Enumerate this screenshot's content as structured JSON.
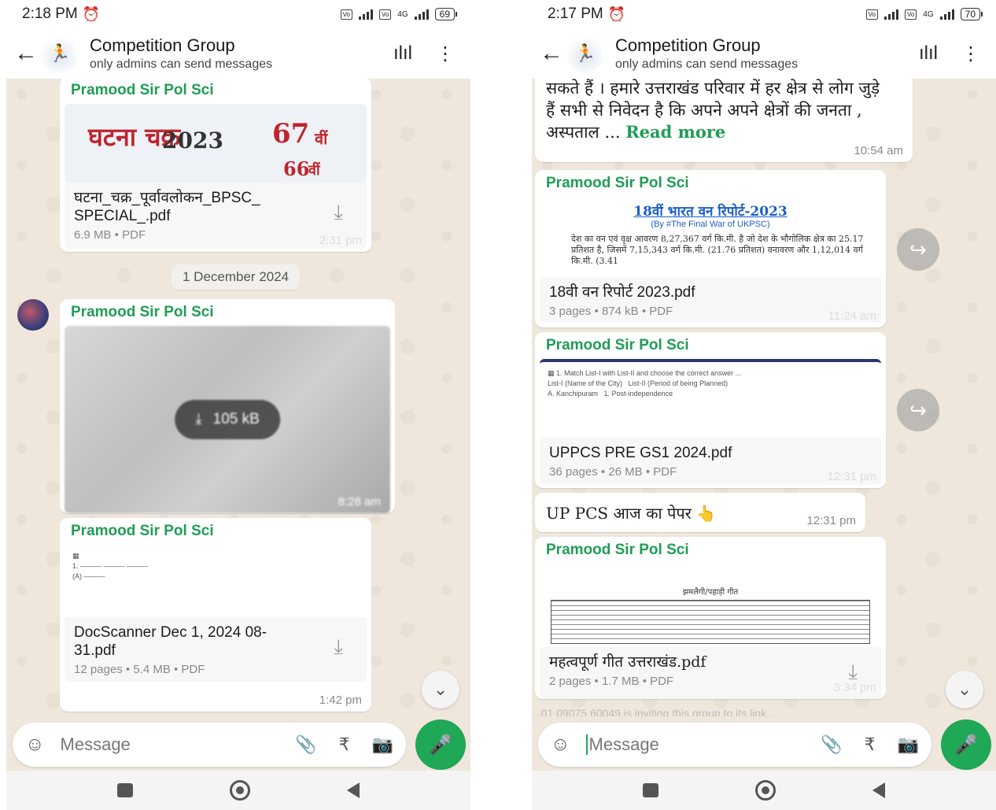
{
  "left": {
    "status": {
      "time": "2:18 PM",
      "battery": "69",
      "network": "4G"
    },
    "header": {
      "title": "Competition Group",
      "subtitle": "only admins can send messages"
    },
    "messages": [
      {
        "sender": "Pramood Sir Pol Sci",
        "thumb_year": "2023",
        "thumb_title": "घटना चक्र",
        "thumb_num1": "67",
        "thumb_num2": "66",
        "thumb_suffix": "वीं",
        "file": "घटना_चक्र_पूर्वावलोकन_BPSC_ SPECIAL_.pdf",
        "meta": "6.9 MB • PDF",
        "time": "2:31 pm"
      },
      {
        "date": "1 December 2024"
      },
      {
        "sender": "Pramood Sir Pol Sci",
        "image_size": "105 kB",
        "time": "8:28 am"
      },
      {
        "sender": "Pramood Sir Pol Sci",
        "file": "DocScanner Dec 1, 2024 08-31.pdf",
        "meta": "12 pages • 5.4 MB • PDF",
        "time": "1:42 pm"
      }
    ],
    "composer": {
      "placeholder": "Message"
    }
  },
  "right": {
    "status": {
      "time": "2:17 PM",
      "battery": "70",
      "network": "4G"
    },
    "header": {
      "title": "Competition Group",
      "subtitle": "only admins can send messages"
    },
    "messages": [
      {
        "text": "सकते हैं । हमारे उत्तराखंड परिवार में हर क्षेत्र से लोग जुड़े हैं सभी से निवेदन है कि अपने अपने क्षेत्रों की जनता , अस्पताल ...",
        "read_more": "Read more",
        "time": "10:54 am"
      },
      {
        "sender": "Pramood Sir Pol Sci",
        "doc_link": "18वीं भारत वन रिपोर्ट-2023",
        "doc_sub": "(By #The Final War of UKPSC)",
        "doc_line": "देश का वन एवं वृक्ष आवरण 8,27,367 वर्ग कि.मी. है जो देश के भौगोलिक क्षेत्र का 25.17 प्रतिशत है, जिसमें 7,15,343 वर्ग कि.मी. (21.76 प्रतिशत) वनावरण और 1,12,014 वर्ग कि.मी. (3.41",
        "file": "18वी वन रिपोर्ट 2023.pdf",
        "meta": "3 pages • 874 kB • PDF",
        "time": "11:24 am"
      },
      {
        "sender": "Pramood Sir Pol Sci",
        "file": "UPPCS PRE GS1 2024.pdf",
        "meta": "36 pages • 26 MB • PDF",
        "time": "12:31 pm"
      },
      {
        "text": "UP PCS आज का पेपर 👆",
        "time": "12:31 pm"
      },
      {
        "sender": "Pramood Sir Pol Sci",
        "doc_heading": "झमलैगी/पहाड़ी गीत",
        "file": "महत्वपूर्ण गीत उत्तराखंड.pdf",
        "meta": "2 pages • 1.7 MB • PDF",
        "time": "3:34 pm"
      },
      {
        "partial": "...01 09075 60049 is inviting this group to its link..."
      }
    ],
    "composer": {
      "placeholder": "Message"
    }
  },
  "icons": [
    "back-arrow-icon",
    "voice-call-icon",
    "more-options-icon",
    "download-icon",
    "forward-icon",
    "scroll-down-icon",
    "emoji-icon",
    "attach-icon",
    "rupee-icon",
    "camera-icon",
    "mic-icon"
  ],
  "colors": {
    "sender": "#1f9d55",
    "mic": "#1fa855",
    "chat_bg": "#efe7dc"
  }
}
